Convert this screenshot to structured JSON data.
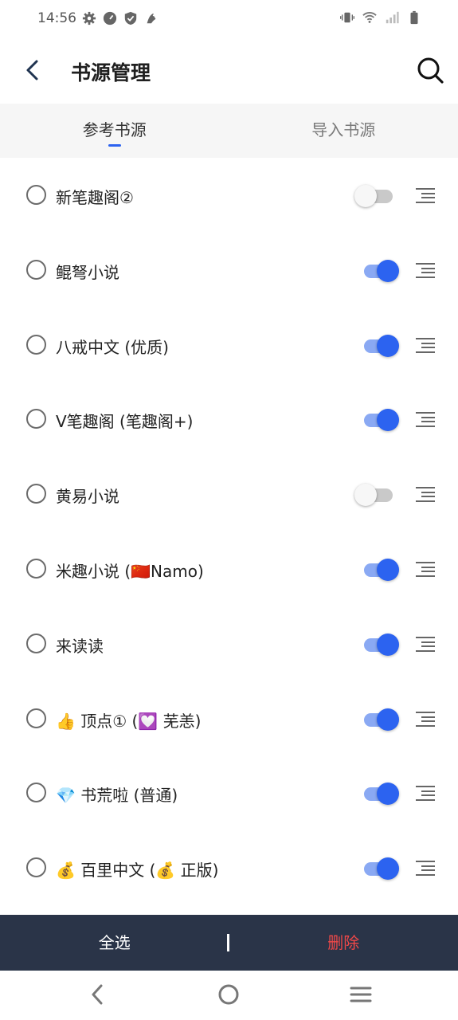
{
  "status_bar": {
    "time": "14:56",
    "left_icons": [
      "gear-icon",
      "speedometer-icon",
      "shield-icon",
      "bird-icon"
    ],
    "right_icons": [
      "vibrate-icon",
      "wifi-icon",
      "signal-icon",
      "battery-icon"
    ]
  },
  "header": {
    "title": "书源管理",
    "back_icon": "arrow-left-icon",
    "search_icon": "search-icon"
  },
  "tabs": [
    {
      "label": "参考书源",
      "active": true
    },
    {
      "label": "导入书源",
      "active": false
    }
  ],
  "sources": [
    {
      "label": "新笔趣阁②",
      "enabled": false
    },
    {
      "label": "鲲弩小说",
      "enabled": true
    },
    {
      "label": "八戒中文 (优质)",
      "enabled": true
    },
    {
      "label": "V笔趣阁 (笔趣阁+)",
      "enabled": true
    },
    {
      "label": "黄易小说",
      "enabled": false
    },
    {
      "label": "米趣小说 (🇨🇳Namo)",
      "enabled": true
    },
    {
      "label": "来读读",
      "enabled": true
    },
    {
      "label": "👍 顶点① (💟 芜恙)",
      "enabled": true
    },
    {
      "label": "💎 书荒啦 (普通)",
      "enabled": true
    },
    {
      "label": "💰 百里中文 (💰 正版)",
      "enabled": true
    }
  ],
  "actions": {
    "select_all": "全选",
    "delete": "删除"
  },
  "navigation": [
    "back-triangle-icon",
    "home-circle-icon",
    "menu-lines-icon"
  ],
  "colors": {
    "accent": "#2c63f0",
    "action_bar": "#2a3448",
    "delete": "#f04848"
  }
}
